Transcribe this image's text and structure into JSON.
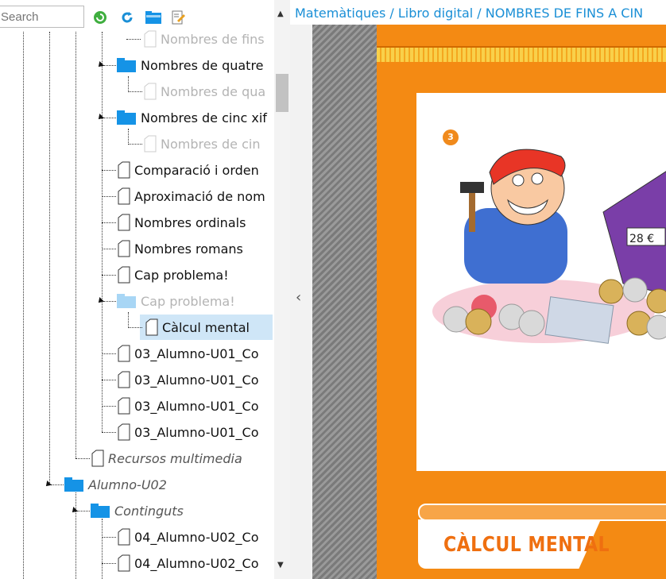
{
  "search": {
    "placeholder": "Search"
  },
  "breadcrumb": {
    "text": "Matemàtiques / Libro digital / NOMBRES DE FINS A CIN"
  },
  "tree": {
    "items": [
      {
        "label": "Nombres de fins"
      },
      {
        "label": "Nombres de quatre"
      },
      {
        "label": "Nombres de qua"
      },
      {
        "label": "Nombres de cinc xif"
      },
      {
        "label": "Nombres de cin"
      },
      {
        "label": "Comparació i orden"
      },
      {
        "label": "Aproximació de nom"
      },
      {
        "label": "Nombres ordinals"
      },
      {
        "label": "Nombres romans"
      },
      {
        "label": "Cap problema!"
      },
      {
        "label": "Cap problema!"
      },
      {
        "label": "Càlcul mental"
      },
      {
        "label": "03_Alumno-U01_Co"
      },
      {
        "label": "03_Alumno-U01_Co"
      },
      {
        "label": "03_Alumno-U01_Co"
      },
      {
        "label": "03_Alumno-U01_Co"
      },
      {
        "label": "Recursos multimedia"
      },
      {
        "label": "Alumno-U02"
      },
      {
        "label": "Continguts"
      },
      {
        "label": "04_Alumno-U02_Co"
      },
      {
        "label": "04_Alumno-U02_Co"
      }
    ]
  },
  "page": {
    "badge": "3",
    "price_tag": "28 €",
    "banner_title": "CÀLCUL MENTAL"
  },
  "colors": {
    "accent": "#1a8fd6",
    "page_orange": "#f48a13",
    "highlight": "#cfe6f7",
    "folder": "#1593e6"
  }
}
